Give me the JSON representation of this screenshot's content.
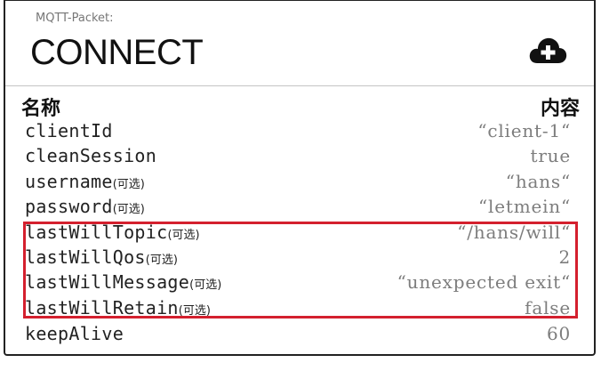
{
  "packet": {
    "subtitle": "MQTT-Packet:",
    "title": "CONNECT",
    "add_icon": "cloud-plus-icon"
  },
  "columns": {
    "name": "名称",
    "value": "内容"
  },
  "fields": [
    {
      "name": "clientId",
      "optional": "",
      "value": "“client-1“"
    },
    {
      "name": "cleanSession",
      "optional": "",
      "value": "true"
    },
    {
      "name": "username",
      "optional": "(可选)",
      "value": "“hans“"
    },
    {
      "name": "password",
      "optional": "(可选)",
      "value": "“letmein“"
    },
    {
      "name": "lastWillTopic",
      "optional": "(可选)",
      "value": "“/hans/will“"
    },
    {
      "name": "lastWillQos",
      "optional": "(可选)",
      "value": "2"
    },
    {
      "name": "lastWillMessage",
      "optional": "(可选)",
      "value": "“unexpected exit“"
    },
    {
      "name": "lastWillRetain",
      "optional": "(可选)",
      "value": "false"
    },
    {
      "name": "keepAlive",
      "optional": "",
      "value": "60"
    }
  ],
  "colors": {
    "highlight": "#d4202e",
    "value_text": "#7d7d7d"
  }
}
